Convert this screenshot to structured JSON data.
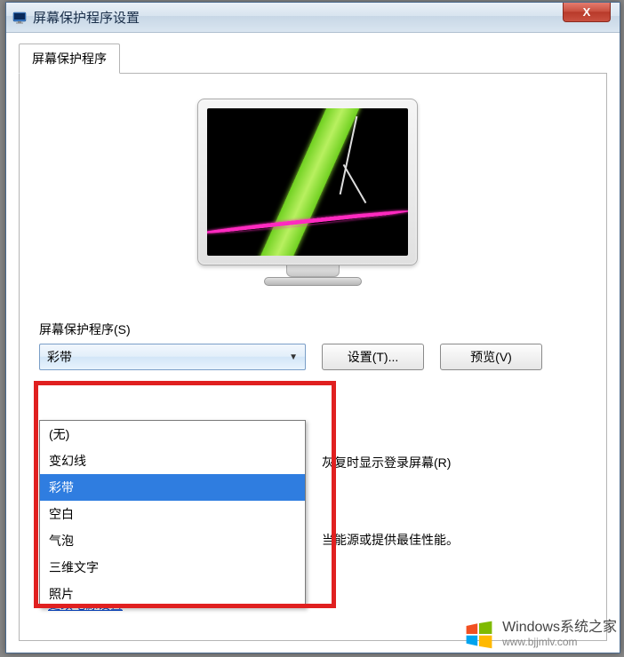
{
  "window": {
    "title": "屏幕保护程序设置",
    "close_label": "X"
  },
  "tab": {
    "label": "屏幕保护程序"
  },
  "section": {
    "label": "屏幕保护程序(S)"
  },
  "dropdown": {
    "selected": "彩带",
    "options": [
      "(无)",
      "变幻线",
      "彩带",
      "空白",
      "气泡",
      "三维文字",
      "照片"
    ],
    "selected_index": 2
  },
  "buttons": {
    "settings": "设置(T)...",
    "preview": "预览(V)"
  },
  "fragments": {
    "resume_text": "灰复时显示登录屏幕(R)",
    "power_text": "当能源或提供最佳性能。",
    "change_power": "更改电源设置"
  },
  "watermark": {
    "title": "Windows系统之家",
    "url": "www.bjjmlv.com"
  }
}
